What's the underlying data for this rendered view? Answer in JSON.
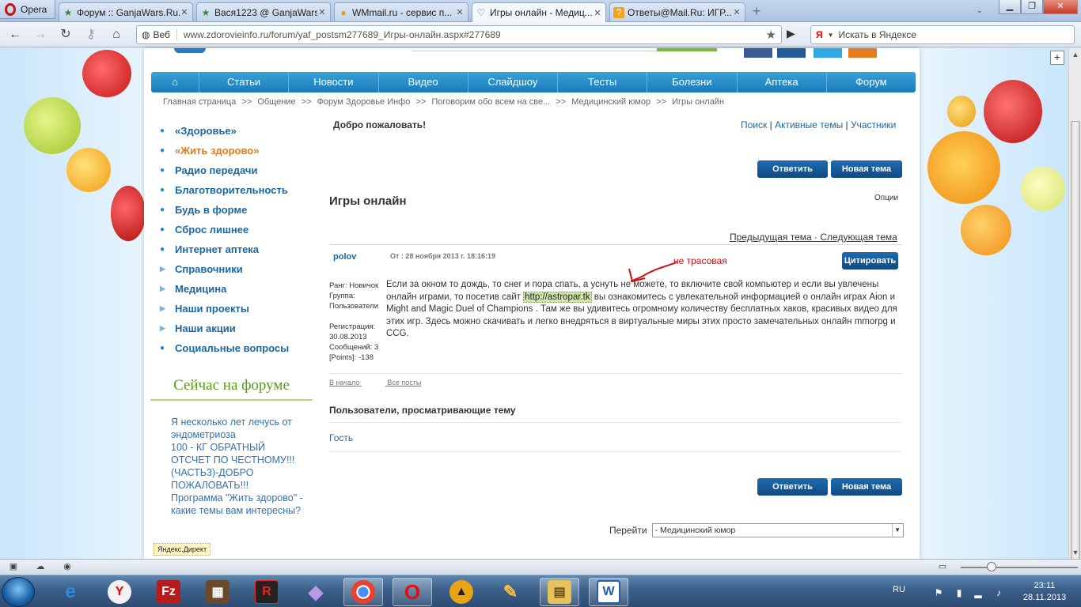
{
  "browser": {
    "menu_label": "Opera",
    "tabs": [
      {
        "title": "Форум :: GanjaWars.Ru...",
        "icon": "star-icon"
      },
      {
        "title": "Вася1223 @ GanjaWars...",
        "icon": "star-icon"
      },
      {
        "title": "WMmail.ru - сервис п...",
        "icon": "wmmail-icon"
      },
      {
        "title": "Игры онлайн - Медиц...",
        "icon": "heart-icon",
        "active": true
      },
      {
        "title": "Ответы@Mail.Ru: ИГР...",
        "icon": "question-icon"
      }
    ],
    "address_prefix": "Веб",
    "url": "www.zdorovieinfo.ru/forum/yaf_postsm277689_Игры-онлайн.aspx#277689",
    "search_placeholder": "Искать в Яндексе",
    "search_engine": "Я"
  },
  "site": {
    "menu": [
      "⌂",
      "Статьи",
      "Новости",
      "Видео",
      "Слайдшоу",
      "Тесты",
      "Болезни",
      "Аптека",
      "Форум"
    ],
    "breadcrumbs": [
      "Главная страница",
      ">>",
      "Общение",
      ">>",
      "Форум Здоровье Инфо",
      ">>",
      "Поговорим обо всем на све...",
      ">>",
      "Медицинский юмор",
      ">>",
      "Игры онлайн"
    ],
    "left_nav": [
      {
        "label": "«Здоровье»",
        "type": "bullet"
      },
      {
        "label": "«Жить здорово»",
        "type": "bullet",
        "highlight": true
      },
      {
        "label": "Радио передачи",
        "type": "bullet"
      },
      {
        "label": "Благотворительность",
        "type": "bullet"
      },
      {
        "label": "Будь в форме",
        "type": "bullet"
      },
      {
        "label": "Сброс лишнее",
        "type": "bullet"
      },
      {
        "label": "Интернет аптека",
        "type": "bullet"
      },
      {
        "label": "Справочники",
        "type": "arrow"
      },
      {
        "label": "Медицина",
        "type": "arrow"
      },
      {
        "label": "Наши проекты",
        "type": "arrow"
      },
      {
        "label": "Наши акции",
        "type": "arrow"
      },
      {
        "label": "Социальные вопросы",
        "type": "bullet"
      }
    ],
    "now_on_forum_title": "Сейчас на форуме",
    "now_on_forum": [
      "Я несколько лет лечусь от эндометриоза",
      "100 - КГ ОБРАТНЫЙ ОТСЧЕТ ПО ЧЕСТНОМУ!!! (ЧАСТЬ3)-ДОБРО ПОЖАЛОВАТЬ!!!",
      "Программа \"Жить здорово\" - какие темы вам интересны?"
    ],
    "yandex_direct": "Яндекс.Директ"
  },
  "forum": {
    "welcome": "Добро пожаловать!",
    "top_links": [
      "Поиск",
      "Активные темы",
      "Участники"
    ],
    "reply_button": "Ответить",
    "new_topic_button": "Новая тема",
    "topic_title": "Игры онлайн",
    "options_label": "Опции",
    "prev_topic": "Предыдущая тема",
    "next_topic": "Следующая тема",
    "prevnext_sep": "·",
    "post": {
      "author": "polov",
      "date": "От : 28 ноября 2013 г. 18:16:19",
      "quote_button": "Цитировать",
      "annotation": "не трасовая",
      "user_info": [
        "Ранг: Новичок",
        "Группа:",
        "Пользователи",
        "",
        "Регистрация:",
        "30.08.2013",
        "Сообщений: 3",
        "[Points]: -138"
      ],
      "text_before": "Если за окном то дождь, то снег и пора спать, а уснуть не можете, то включите свой компьютер и если вы увлечены онлайн играми, то посетив сайт ",
      "link": "http://astropar.tk",
      "text_after": " вы ознакомитесь с увлекательной информацией о онлайн играх Aion и Might and Magic Duel of Champions . Там же вы удивитесь огромному количеству бесплатных хаков, красивых видео для этих игр. Здесь можно скачивать и легко внедряться в виртуальные миры этих просто замечательных онлайн mmorpg и CCG."
    },
    "post_links": [
      "В начало",
      "Все посты"
    ],
    "viewers_title": "Пользователи, просматривающие тему",
    "viewer": "Гость",
    "goto_label": "Перейти",
    "goto_value": "- Медицинский юмор"
  },
  "taskbar": {
    "apps": [
      {
        "name": "ie",
        "label": "e",
        "color": "#2b8be0"
      },
      {
        "name": "yandex-browser",
        "label": "Y",
        "color": "#e8e8e8"
      },
      {
        "name": "filezilla",
        "label": "Fz",
        "color": "#b81b1b"
      },
      {
        "name": "film-app",
        "label": "▦",
        "color": "#6a4a2a"
      },
      {
        "name": "r-app",
        "label": "R",
        "color": "#222"
      },
      {
        "name": "visual-studio",
        "label": "◆",
        "color": "#7a5ab5"
      },
      {
        "name": "chrome",
        "label": "●",
        "color": "#2e9b3a"
      },
      {
        "name": "opera",
        "label": "O",
        "color": "#d11"
      },
      {
        "name": "aimp",
        "label": "▲",
        "color": "#e7a415"
      },
      {
        "name": "paint",
        "label": "✎",
        "color": "#7fa9d6"
      },
      {
        "name": "explorer",
        "label": "▤",
        "color": "#e7c15a"
      },
      {
        "name": "word",
        "label": "W",
        "color": "#2b5aa8"
      }
    ],
    "language": "RU",
    "time": "23:11",
    "date": "28.11.2013"
  }
}
